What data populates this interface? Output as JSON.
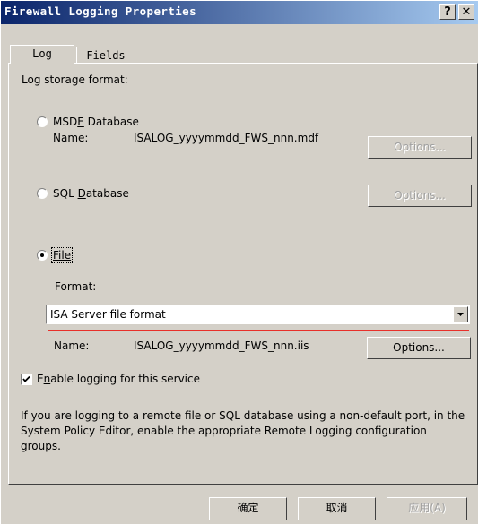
{
  "window": {
    "title": "Firewall Logging Properties",
    "help_label": "?",
    "close_label": "✕"
  },
  "tabs": [
    {
      "label": "Log"
    },
    {
      "label": "Fields"
    }
  ],
  "log": {
    "storage_label": "Log storage format:",
    "msde": {
      "pre": "MSD",
      "u": "E",
      "post": " Database",
      "name_label": "Name:",
      "name_value": "ISALOG_yyyymmdd_FWS_nnn.mdf",
      "options_label": "Options..."
    },
    "sql": {
      "pre": "SQL ",
      "u": "D",
      "post": "atabase",
      "options_label": "Options..."
    },
    "file": {
      "label": "File",
      "format_label": "Format:",
      "format_value": "ISA Server file format",
      "name_label": "Name:",
      "name_value": "ISALOG_yyyymmdd_FWS_nnn.iis",
      "options_label": "Options..."
    },
    "enable": {
      "pre": "E",
      "u": "n",
      "post": "able logging for this service",
      "checked": true
    },
    "note": "If you are logging to a remote file or SQL database using a non-default port, in the System Policy Editor, enable the appropriate Remote Logging configuration groups."
  },
  "footer": {
    "ok_label": "确定",
    "cancel_label": "取消",
    "apply_label": "应用(A)"
  },
  "colors": {
    "title_start": "#0a246a",
    "title_end": "#a6caf0",
    "face": "#d4d0c8",
    "annotation": "#e8302a"
  }
}
